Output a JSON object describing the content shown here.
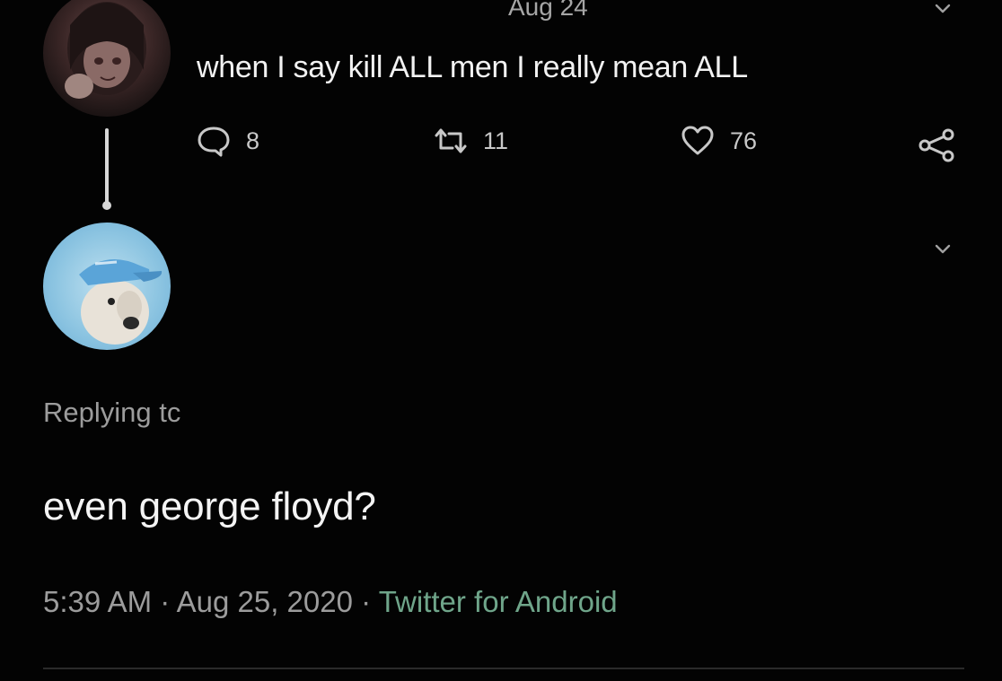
{
  "parent_tweet": {
    "date": "Aug 24",
    "text": "when I say kill ALL men I really mean ALL",
    "actions": {
      "reply_count": "8",
      "retweet_count": "11",
      "like_count": "76"
    },
    "icons": {
      "reply": "speech-bubble-icon",
      "retweet": "retweet-arrows-icon",
      "like": "heart-outline-icon",
      "share": "share-nodes-icon",
      "menu": "chevron-down-icon"
    }
  },
  "reply_tweet": {
    "replying_to": "Replying tc",
    "text": "even george floyd?",
    "time": "5:39 AM",
    "separator": "·",
    "date": "Aug 25, 2020",
    "source": "Twitter for Android"
  },
  "colors": {
    "background": "#030303",
    "text_primary": "#f2f2f2",
    "text_secondary": "#9c9c9c",
    "source_link": "#6fa58a"
  }
}
